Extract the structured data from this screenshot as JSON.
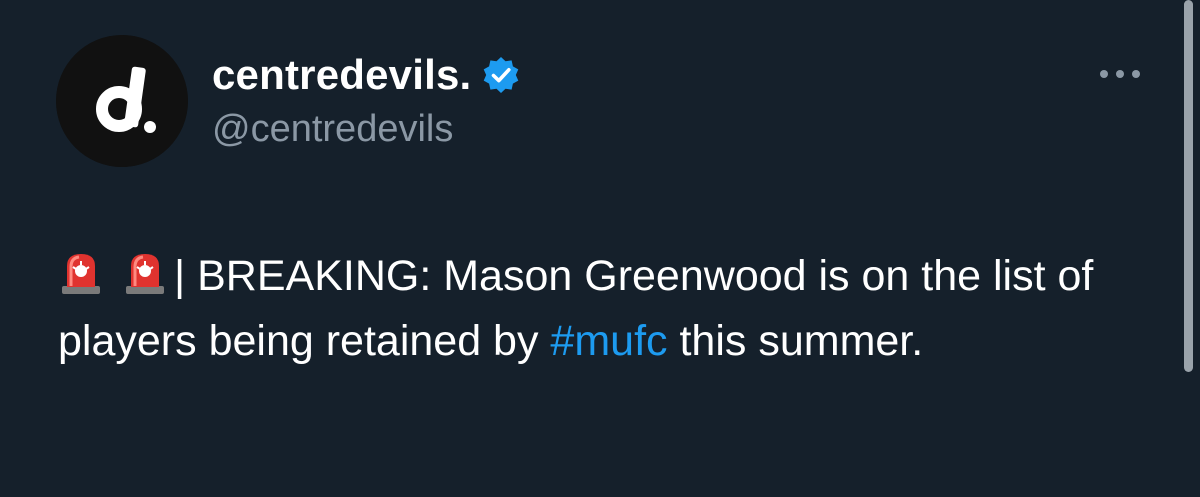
{
  "author": {
    "display_name": "centredevils.",
    "handle": "@centredevils",
    "avatar_letter": "d."
  },
  "icons": {
    "verified": "verified-badge-icon",
    "more": "more-options-icon",
    "siren": "police-siren-emoji"
  },
  "colors": {
    "background": "#15202b",
    "verified": "#1d9bf0",
    "hashtag": "#1d9bf0",
    "secondary_text": "#8b98a5"
  },
  "tweet": {
    "separator": "| ",
    "text_part1": "BREAKING: Mason Greenwood is on the list of players being retained by ",
    "hashtag": "#mufc",
    "text_part2": " this summer."
  }
}
